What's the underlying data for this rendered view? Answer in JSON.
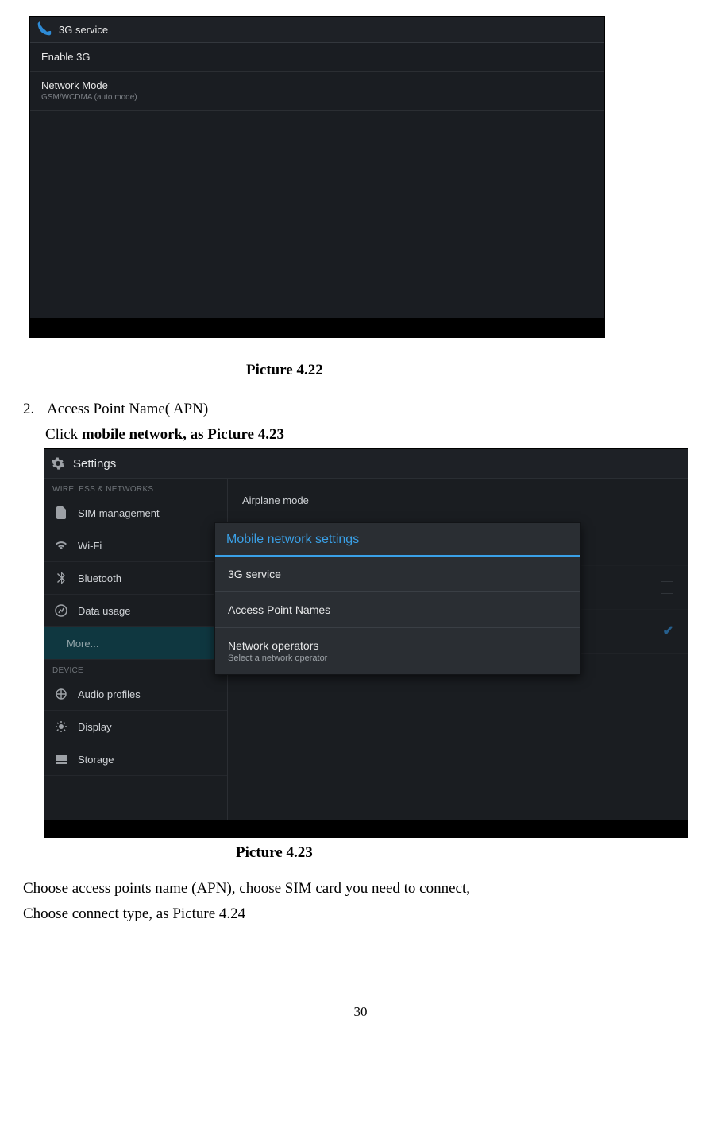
{
  "screenshot1": {
    "title": "3G service",
    "rows": [
      {
        "label": "Enable 3G"
      },
      {
        "label": "Network Mode",
        "sub": "GSM/WCDMA (auto mode)"
      }
    ]
  },
  "caption1": "Picture 4.22",
  "list_item_num": "2.",
  "list_item_text": "Access Point Name( APN)",
  "click_text_a": "Click ",
  "click_text_b": "mobile network, as Picture 4.23",
  "screenshot2": {
    "title": "Settings",
    "left_section1": "WIRELESS & NETWORKS",
    "left_items1": [
      "SIM management",
      "Wi-Fi",
      "Bluetooth",
      "Data usage",
      "More..."
    ],
    "left_section2": "DEVICE",
    "left_items2": [
      "Audio profiles",
      "Display",
      "Storage"
    ],
    "right_airplane": "Airplane mode",
    "dialog": {
      "title": "Mobile network settings",
      "items": [
        {
          "label": "3G service"
        },
        {
          "label": "Access Point Names"
        },
        {
          "label": "Network operators",
          "sub": "Select a network operator"
        }
      ]
    }
  },
  "caption2": "Picture 4.23",
  "para1": "Choose access points name (APN), choose SIM card you need to connect,",
  "para2": "Choose connect type, as Picture 4.24",
  "page_number": "30"
}
